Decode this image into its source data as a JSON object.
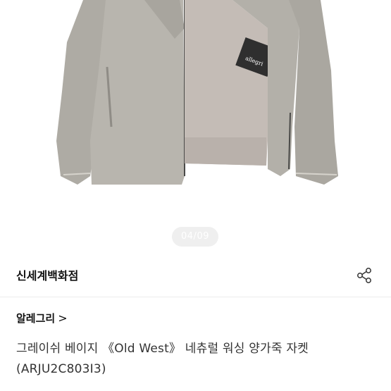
{
  "gallery": {
    "page_indicator": "04/09",
    "image_alt": "jacket product photo",
    "label_text": "allegri"
  },
  "store": {
    "name": "신세계백화점",
    "share_icon": "share-icon"
  },
  "product": {
    "brand_link": "알레그리",
    "brand_chevron": ">",
    "title": "그레이쉬 베이지 《Old West》 네츄럴 워싱 양가죽 자켓 (ARJU2C803I3)"
  },
  "colors": {
    "jacket": "#b7b4ad",
    "lining": "#c6bdb7",
    "indicator_bg": "#efefef"
  }
}
